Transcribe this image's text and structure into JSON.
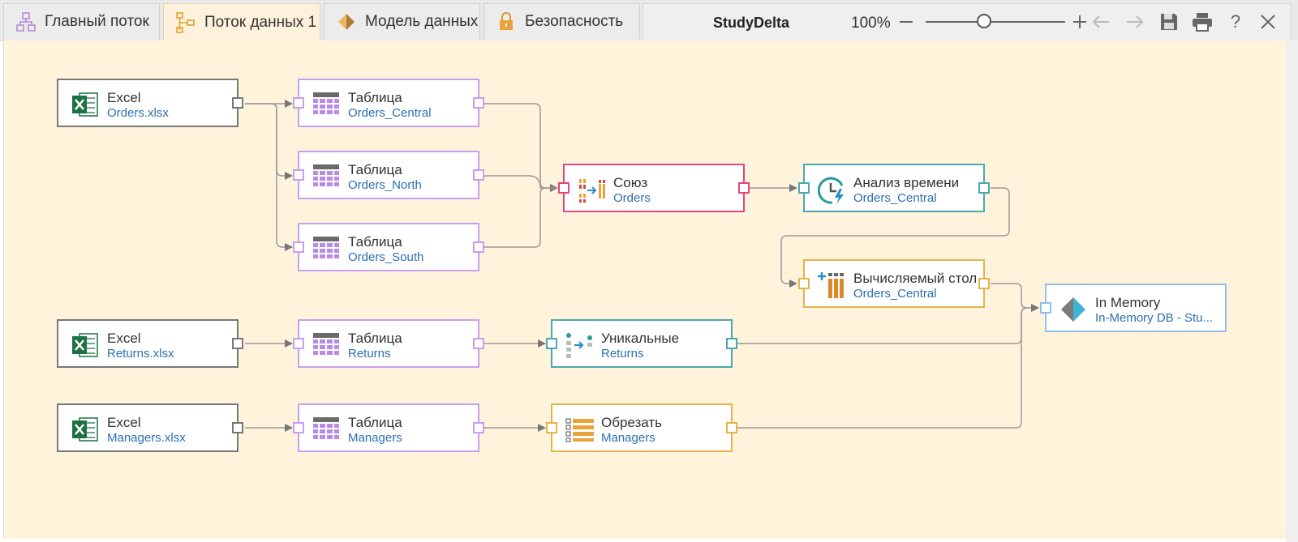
{
  "tabs": [
    {
      "label": "Главный поток",
      "icon": "hierarchy-icon",
      "active": false
    },
    {
      "label": "Поток данных 1",
      "icon": "dataflow-icon",
      "active": true
    },
    {
      "label": "Модель данных",
      "icon": "diamond-icon",
      "active": false
    },
    {
      "label": "Безопасность",
      "icon": "lock-icon",
      "active": false
    }
  ],
  "toolbar": {
    "project_name": "StudyDelta",
    "zoom_label": "100%",
    "zoom_value": 1.0,
    "zoom_slider_fraction": 0.42,
    "zoom_out_icon": "minus-icon",
    "zoom_in_icon": "plus-icon",
    "undo_icon": "arrow-left-icon",
    "redo_icon": "arrow-right-icon",
    "save_icon": "save-icon",
    "print_icon": "print-icon",
    "help_label": "?",
    "close_icon": "close-icon"
  },
  "colors": {
    "canvas_bg": "#fff3dc",
    "source_border": "#777777",
    "table_border": "#c79ff0",
    "union_border": "#e0477f",
    "teal_border": "#4aa8b0",
    "orange_border": "#e6b34a",
    "memory_border": "#8fc0ea",
    "subtitle_text": "#2b6fb0",
    "excel_green": "#1e7145",
    "table_purple": "#b98ae6"
  },
  "nodes": {
    "excel_orders": {
      "title": "Excel",
      "subtitle": "Orders.xlsx",
      "icon": "excel-icon"
    },
    "table_central": {
      "title": "Таблица",
      "subtitle": "Orders_Central",
      "icon": "table-icon"
    },
    "table_north": {
      "title": "Таблица",
      "subtitle": "Orders_North",
      "icon": "table-icon"
    },
    "table_south": {
      "title": "Таблица",
      "subtitle": "Orders_South",
      "icon": "table-icon"
    },
    "union": {
      "title": "Союз",
      "subtitle": "Orders",
      "icon": "union-icon"
    },
    "time_analysis": {
      "title": "Анализ времени",
      "subtitle": "Orders_Central",
      "icon": "clock-lightning-icon"
    },
    "calc_column": {
      "title": "Вычисляемый стол",
      "subtitle": "Orders_Central",
      "icon": "calculated-column-icon"
    },
    "in_memory": {
      "title": "In Memory",
      "subtitle": "In-Memory DB - Stu...",
      "icon": "in-memory-db-icon"
    },
    "excel_returns": {
      "title": "Excel",
      "subtitle": "Returns.xlsx",
      "icon": "excel-icon"
    },
    "table_returns": {
      "title": "Таблица",
      "subtitle": "Returns",
      "icon": "table-icon"
    },
    "unique": {
      "title": "Уникальные",
      "subtitle": "Returns",
      "icon": "distinct-icon"
    },
    "excel_managers": {
      "title": "Excel",
      "subtitle": "Managers.xlsx",
      "icon": "excel-icon"
    },
    "table_managers": {
      "title": "Таблица",
      "subtitle": "Managers",
      "icon": "table-icon"
    },
    "trim": {
      "title": "Обрезать",
      "subtitle": "Managers",
      "icon": "trim-icon"
    }
  },
  "connections": [
    [
      "excel_orders",
      "table_central"
    ],
    [
      "excel_orders",
      "table_north"
    ],
    [
      "excel_orders",
      "table_south"
    ],
    [
      "table_central",
      "union"
    ],
    [
      "table_north",
      "union"
    ],
    [
      "table_south",
      "union"
    ],
    [
      "union",
      "time_analysis"
    ],
    [
      "time_analysis",
      "calc_column"
    ],
    [
      "calc_column",
      "in_memory"
    ],
    [
      "unique",
      "in_memory"
    ],
    [
      "trim",
      "in_memory"
    ],
    [
      "excel_returns",
      "table_returns"
    ],
    [
      "table_returns",
      "unique"
    ],
    [
      "excel_managers",
      "table_managers"
    ],
    [
      "table_managers",
      "trim"
    ]
  ]
}
